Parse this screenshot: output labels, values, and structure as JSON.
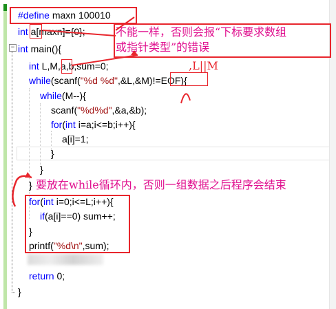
{
  "editor": {
    "lines": [
      [
        {
          "t": "#define",
          "c": "pp"
        },
        {
          "t": " maxn 100010",
          "c": ""
        }
      ],
      [
        {
          "t": "int",
          "c": "kw"
        },
        {
          "t": " a[maxn]={0};",
          "c": ""
        }
      ],
      [
        {
          "t": "int",
          "c": "kw"
        },
        {
          "t": " main(){",
          "c": ""
        }
      ],
      [
        {
          "t": "int",
          "c": "kw"
        },
        {
          "t": " L,M,a,b,sum=0;",
          "c": ""
        }
      ],
      [
        {
          "t": "while",
          "c": "kw"
        },
        {
          "t": "(scanf(",
          "c": ""
        },
        {
          "t": "\"%d %d\"",
          "c": "str"
        },
        {
          "t": ",&L,&M)!=EOF){",
          "c": ""
        }
      ],
      [
        {
          "t": "while",
          "c": "kw"
        },
        {
          "t": "(M--){",
          "c": ""
        }
      ],
      [
        {
          "t": "scanf(",
          "c": ""
        },
        {
          "t": "\"%d%d\"",
          "c": "str"
        },
        {
          "t": ",&a,&b);",
          "c": ""
        }
      ],
      [
        {
          "t": "for",
          "c": "kw"
        },
        {
          "t": "(",
          "c": ""
        },
        {
          "t": "int",
          "c": "kw"
        },
        {
          "t": " i=a;i<=b;i++){",
          "c": ""
        }
      ],
      [
        {
          "t": "a[i]=1;",
          "c": ""
        }
      ],
      [
        {
          "t": "}",
          "c": ""
        }
      ],
      [
        {
          "t": "}",
          "c": ""
        }
      ],
      [
        {
          "t": "}",
          "c": ""
        }
      ],
      [
        {
          "t": "for",
          "c": "kw"
        },
        {
          "t": "(",
          "c": ""
        },
        {
          "t": "int",
          "c": "kw"
        },
        {
          "t": " i=0;i<=L;i++){",
          "c": ""
        }
      ],
      [
        {
          "t": "if",
          "c": "kw"
        },
        {
          "t": "(a[i]==0) sum++;",
          "c": ""
        }
      ],
      [
        {
          "t": "}",
          "c": ""
        }
      ],
      [
        {
          "t": "printf(",
          "c": ""
        },
        {
          "t": "\"%d\\n\"",
          "c": "str"
        },
        {
          "t": ",sum);",
          "c": ""
        }
      ],
      [],
      [
        {
          "t": "return",
          "c": "kw"
        },
        {
          "t": " 0;",
          "c": ""
        }
      ],
      [
        {
          "t": "}",
          "c": ""
        }
      ]
    ]
  },
  "annotations": {
    "note1_line1": "不能一样，否则会报“下标要求数组",
    "note1_line2": "或指针类型”的错误",
    "note_lm": ",L||M",
    "note2": "要放在while循环内，否则一组数据之后程序会结束"
  },
  "colors": {
    "keyword": "#0000ff",
    "string": "#a31515",
    "annotation_box": "#e8262d",
    "annotation_text": "#e0108f",
    "change_bar": "#bfe6a8"
  },
  "icons": {
    "fold_open": "minus-box-icon",
    "change_indicator": "change-bar-icon"
  }
}
